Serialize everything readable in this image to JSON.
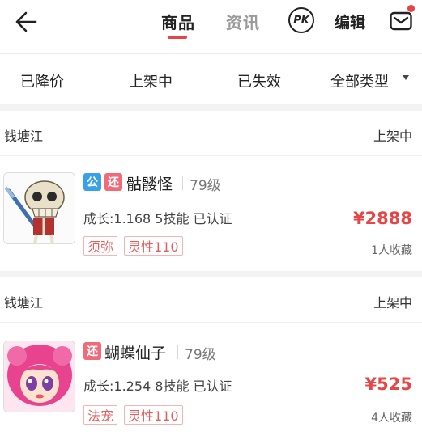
{
  "header": {
    "tabs": [
      {
        "label": "商品",
        "active": true
      },
      {
        "label": "资讯",
        "active": false
      }
    ],
    "pk_label": "PK",
    "edit_label": "编辑",
    "accent": "#e64545"
  },
  "filters": [
    {
      "label": "已降价"
    },
    {
      "label": "上架中"
    },
    {
      "label": "已失效"
    },
    {
      "label": "全部类型"
    }
  ],
  "listings": [
    {
      "seller": "钱塘江",
      "status": "上架中",
      "badges": [
        "公",
        "还"
      ],
      "name": "骷髅怪",
      "level": "79级",
      "stats": "成长:1.168 5技能 已认证",
      "tags": [
        "须弥",
        "灵性110"
      ],
      "price": "¥2888",
      "favorites": "1人收藏",
      "image_icon": "skeleton-pet-icon"
    },
    {
      "seller": "钱塘江",
      "status": "上架中",
      "badges": [
        "还"
      ],
      "name": "蝴蝶仙子",
      "level": "79级",
      "stats": "成长:1.254 8技能 已认证",
      "tags": [
        "法宠",
        "灵性110"
      ],
      "price": "¥525",
      "favorites": "4人收藏",
      "image_icon": "butterfly-fairy-pet-icon"
    }
  ]
}
